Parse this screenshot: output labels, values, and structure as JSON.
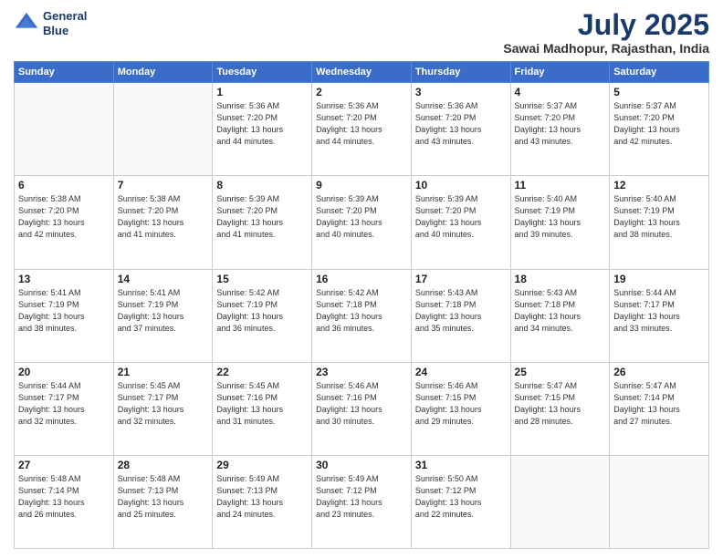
{
  "header": {
    "logo_line1": "General",
    "logo_line2": "Blue",
    "month": "July 2025",
    "location": "Sawai Madhopur, Rajasthan, India"
  },
  "weekdays": [
    "Sunday",
    "Monday",
    "Tuesday",
    "Wednesday",
    "Thursday",
    "Friday",
    "Saturday"
  ],
  "weeks": [
    [
      {
        "day": "",
        "info": ""
      },
      {
        "day": "",
        "info": ""
      },
      {
        "day": "1",
        "info": "Sunrise: 5:36 AM\nSunset: 7:20 PM\nDaylight: 13 hours\nand 44 minutes."
      },
      {
        "day": "2",
        "info": "Sunrise: 5:36 AM\nSunset: 7:20 PM\nDaylight: 13 hours\nand 44 minutes."
      },
      {
        "day": "3",
        "info": "Sunrise: 5:36 AM\nSunset: 7:20 PM\nDaylight: 13 hours\nand 43 minutes."
      },
      {
        "day": "4",
        "info": "Sunrise: 5:37 AM\nSunset: 7:20 PM\nDaylight: 13 hours\nand 43 minutes."
      },
      {
        "day": "5",
        "info": "Sunrise: 5:37 AM\nSunset: 7:20 PM\nDaylight: 13 hours\nand 42 minutes."
      }
    ],
    [
      {
        "day": "6",
        "info": "Sunrise: 5:38 AM\nSunset: 7:20 PM\nDaylight: 13 hours\nand 42 minutes."
      },
      {
        "day": "7",
        "info": "Sunrise: 5:38 AM\nSunset: 7:20 PM\nDaylight: 13 hours\nand 41 minutes."
      },
      {
        "day": "8",
        "info": "Sunrise: 5:39 AM\nSunset: 7:20 PM\nDaylight: 13 hours\nand 41 minutes."
      },
      {
        "day": "9",
        "info": "Sunrise: 5:39 AM\nSunset: 7:20 PM\nDaylight: 13 hours\nand 40 minutes."
      },
      {
        "day": "10",
        "info": "Sunrise: 5:39 AM\nSunset: 7:20 PM\nDaylight: 13 hours\nand 40 minutes."
      },
      {
        "day": "11",
        "info": "Sunrise: 5:40 AM\nSunset: 7:19 PM\nDaylight: 13 hours\nand 39 minutes."
      },
      {
        "day": "12",
        "info": "Sunrise: 5:40 AM\nSunset: 7:19 PM\nDaylight: 13 hours\nand 38 minutes."
      }
    ],
    [
      {
        "day": "13",
        "info": "Sunrise: 5:41 AM\nSunset: 7:19 PM\nDaylight: 13 hours\nand 38 minutes."
      },
      {
        "day": "14",
        "info": "Sunrise: 5:41 AM\nSunset: 7:19 PM\nDaylight: 13 hours\nand 37 minutes."
      },
      {
        "day": "15",
        "info": "Sunrise: 5:42 AM\nSunset: 7:19 PM\nDaylight: 13 hours\nand 36 minutes."
      },
      {
        "day": "16",
        "info": "Sunrise: 5:42 AM\nSunset: 7:18 PM\nDaylight: 13 hours\nand 36 minutes."
      },
      {
        "day": "17",
        "info": "Sunrise: 5:43 AM\nSunset: 7:18 PM\nDaylight: 13 hours\nand 35 minutes."
      },
      {
        "day": "18",
        "info": "Sunrise: 5:43 AM\nSunset: 7:18 PM\nDaylight: 13 hours\nand 34 minutes."
      },
      {
        "day": "19",
        "info": "Sunrise: 5:44 AM\nSunset: 7:17 PM\nDaylight: 13 hours\nand 33 minutes."
      }
    ],
    [
      {
        "day": "20",
        "info": "Sunrise: 5:44 AM\nSunset: 7:17 PM\nDaylight: 13 hours\nand 32 minutes."
      },
      {
        "day": "21",
        "info": "Sunrise: 5:45 AM\nSunset: 7:17 PM\nDaylight: 13 hours\nand 32 minutes."
      },
      {
        "day": "22",
        "info": "Sunrise: 5:45 AM\nSunset: 7:16 PM\nDaylight: 13 hours\nand 31 minutes."
      },
      {
        "day": "23",
        "info": "Sunrise: 5:46 AM\nSunset: 7:16 PM\nDaylight: 13 hours\nand 30 minutes."
      },
      {
        "day": "24",
        "info": "Sunrise: 5:46 AM\nSunset: 7:15 PM\nDaylight: 13 hours\nand 29 minutes."
      },
      {
        "day": "25",
        "info": "Sunrise: 5:47 AM\nSunset: 7:15 PM\nDaylight: 13 hours\nand 28 minutes."
      },
      {
        "day": "26",
        "info": "Sunrise: 5:47 AM\nSunset: 7:14 PM\nDaylight: 13 hours\nand 27 minutes."
      }
    ],
    [
      {
        "day": "27",
        "info": "Sunrise: 5:48 AM\nSunset: 7:14 PM\nDaylight: 13 hours\nand 26 minutes."
      },
      {
        "day": "28",
        "info": "Sunrise: 5:48 AM\nSunset: 7:13 PM\nDaylight: 13 hours\nand 25 minutes."
      },
      {
        "day": "29",
        "info": "Sunrise: 5:49 AM\nSunset: 7:13 PM\nDaylight: 13 hours\nand 24 minutes."
      },
      {
        "day": "30",
        "info": "Sunrise: 5:49 AM\nSunset: 7:12 PM\nDaylight: 13 hours\nand 23 minutes."
      },
      {
        "day": "31",
        "info": "Sunrise: 5:50 AM\nSunset: 7:12 PM\nDaylight: 13 hours\nand 22 minutes."
      },
      {
        "day": "",
        "info": ""
      },
      {
        "day": "",
        "info": ""
      }
    ]
  ]
}
